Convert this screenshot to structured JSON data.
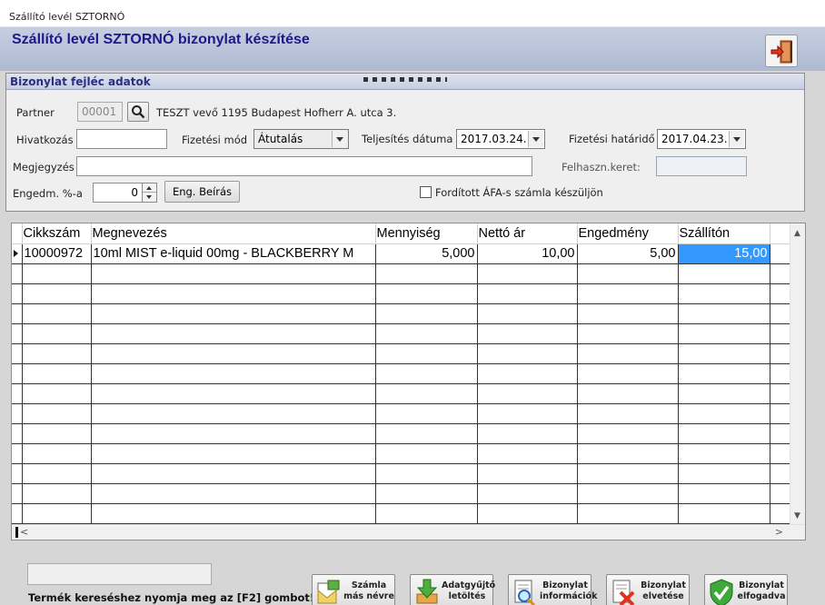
{
  "window": {
    "title": "Szállító levél SZTORNÓ"
  },
  "header": {
    "heading": "Szállító levél SZTORNÓ bizonylat készítése"
  },
  "group": {
    "title": "Bizonylat fejléc adatok"
  },
  "form": {
    "partner_label": "Partner",
    "partner_code": "00001",
    "partner_name": "TESZT vevő 1195 Budapest Hofherr A. utca 3.",
    "hivatkozas_label": "Hivatkozás",
    "hivatkozas_value": "",
    "fizetesi_mod_label": "Fizetési mód",
    "fizetesi_mod_value": "Átutalás",
    "teljesites_label": "Teljesítés dátuma",
    "teljesites_value": "2017.03.24.",
    "hatarido_label": "Fizetési határidő",
    "hatarido_value": "2017.04.23.",
    "megjegyzes_label": "Megjegyzés",
    "megjegyzes_value": "",
    "felhaszn_label": "Felhaszn.keret:",
    "felhaszn_value": "",
    "engedm_label": "Engedm. %-a",
    "engedm_value": "0",
    "eng_beiras_label": "Eng. Beírás",
    "forditott_afa_label": "Fordított ÁFA-s számla készüljön",
    "forditott_afa_checked": false
  },
  "grid": {
    "columns": [
      "Cikkszám",
      "Megnevezés",
      "Mennyiség",
      "Nettó ár",
      "Engedmény",
      "Szállítón"
    ],
    "rows": [
      {
        "cikkszam": "10000972",
        "megnevezes": "10ml MIST e-liquid 00mg - BLACKBERRY M",
        "mennyiseg": "5,000",
        "netto_ar": "10,00",
        "engedmeny": "5,00",
        "szallitón": "15,00"
      }
    ],
    "selection_color": "#3399ff"
  },
  "footer": {
    "hint": "Termék kereséshez nyomja meg az [F2] gombot!",
    "buttons": [
      {
        "label": "Számla más névre",
        "icon": "invoice-envelope-icon"
      },
      {
        "label": "Adatgyűjtő letöltés",
        "icon": "download-arrow-icon"
      },
      {
        "label": "Bizonylat információk",
        "icon": "document-magnifier-icon"
      },
      {
        "label": "Bizonylat elvetése",
        "icon": "document-delete-icon"
      },
      {
        "label": "Bizonylat elfogadva",
        "icon": "checkmark-shield-icon"
      }
    ]
  },
  "colors": {
    "heading": "#1c1a8a",
    "group_title": "#2b2f83",
    "header_band": "#aebad3"
  }
}
